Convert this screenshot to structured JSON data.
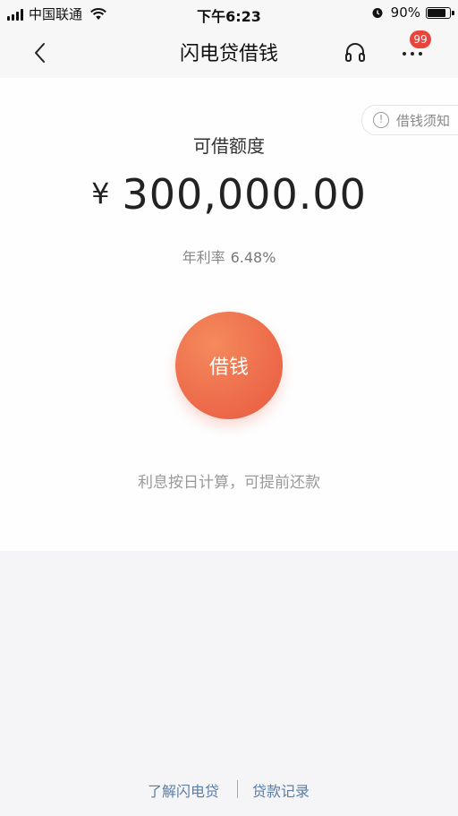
{
  "status_bar": {
    "carrier": "中国联通",
    "time": "下午6:23",
    "battery_percent": "90%",
    "battery_level": 0.9
  },
  "nav": {
    "title": "闪电贷借钱",
    "badge_count": "99",
    "icons": {
      "back": "chevron-left-icon",
      "support": "headset-icon",
      "more": "more-dots-icon"
    }
  },
  "card": {
    "notice_label": "借钱须知",
    "limit_label": "可借额度",
    "currency_symbol": "¥",
    "amount": "300,000.00",
    "rate_label": "年利率",
    "rate_value": "6.48%",
    "borrow_label": "借钱",
    "interest_note": "利息按日计算，可提前还款"
  },
  "footer": {
    "learn_link": "了解闪电贷",
    "records_link": "贷款记录"
  },
  "colors": {
    "accent": "#ee6e4c",
    "badge": "#e8453c",
    "link": "#5a7ea9",
    "background": "#f5f5f7"
  }
}
